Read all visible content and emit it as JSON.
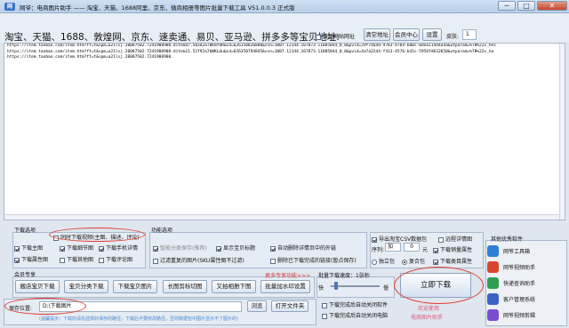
{
  "window": {
    "title": "网爷：电商图片助手 —— 淘宝、天猫、1688阿里、京东、微商相册等图片批量下载工具 V51.0.0.3 正式版",
    "icon": "网",
    "min": "─",
    "max": "□",
    "close": "✕"
  },
  "topbar": {
    "platforms": "淘宝、天猫、1688、敦煌网、京东、速卖通、易贝、亚马逊、拼多多等宝贝地址:",
    "auto_paste": "自动粘贴网址",
    "clear": "清空地址",
    "member": "会员中心",
    "settings": "设置",
    "skin_label": "皮肤:",
    "skin_value": "1"
  },
  "urls": [
    "https://item.taobao.com/item.htm?ft=t&spm=a21lsj.20087502.7241908900.ditem47.503d2a7bKmfdR&id=626150826880&ssn=1007.12144.167873.11085844_0_0&pvid=29f7da4d-9783-4704-b80c-0dea114d4a4a&utparam=%7B%22x_hes",
    "https://item.taobao.com/item.htm?ft=t&spm=a21lsj.20087502.7241908900.ditem11.52f92a7bWKLdu&id=626350794845&ssn=1007.12144.167873.11085844_0_0&pvid=4a7a2244-f413-4576-b41c-5956fd632650&utparam=%7B%22x_ha",
    "https://item.taobao.com/item.htm?ft=t&spm=a21lsj.20087502.7241908900."
  ],
  "opts": {
    "title": "下载选项",
    "video": "同时下载视频(主图、描述、评论)",
    "main": "下载主图",
    "detail_img": "下载细节图",
    "sku": "下载手机详情",
    "attr": "下载属性图",
    "other": "下载其他图",
    "review": "下载评论图"
  },
  "func": {
    "title": "功能选项",
    "smart_cat": "智能分类保存(推荐)",
    "show_title": "显示宝贝标题",
    "auto_del": "自动删除详情页中的外链",
    "filter_dup": "过滤重复的图片(SKU属性图不过滤)",
    "del_done": "删除已下载完成的链接(暂点保存)"
  },
  "extra": {
    "export_csv": "导出淘宝CSV数据包",
    "remote_detail": "远程详情图",
    "seq_label": "序列:",
    "seq_add": "加",
    "seq_num": "0",
    "seq_unit": "元",
    "dl_all_attr": "下载销量属性",
    "dl_attr_shop": "下载类目属性",
    "single": "独立包",
    "multi": "复合包"
  },
  "member": {
    "title": "会员专享",
    "b1": "搬店宝贝下载",
    "b2": "宝贝分类下载",
    "b3": "下载宝贝图片",
    "b4": "长图剪标切图",
    "b5": "又拍相册下图",
    "b6": "批量加水印设置",
    "more": "更多专享功能>>>"
  },
  "batch": {
    "title": "批量下载速度：1张秒",
    "slow": "快",
    "fast": "慢",
    "auto_off": "下载完成后自动关闭软件",
    "auto_pc": "下载完成后自动关闭电脑"
  },
  "save": {
    "label": "保存位置:",
    "path": "D:\\下载图片",
    "browse": "浏览",
    "open": "打开文件夹",
    "hint": "(温馨提示：下载前请先选择好保存的路径，下载后不要修改路径，否则数据包中图片显示不了图片的)"
  },
  "start": {
    "label": "立即下载",
    "welcome": "欢迎使用",
    "brand": "电商图片助手"
  },
  "side": {
    "title": "其他优秀软件",
    "items": [
      {
        "label": "网爷工具箱",
        "color": "#2f7fd7"
      },
      {
        "label": "网爷视频助手",
        "color": "#d8462e"
      },
      {
        "label": "快递查询助手",
        "color": "#2f9e52"
      },
      {
        "label": "客户管理系统",
        "color": "#3b62c5"
      },
      {
        "label": "网爷视频剪辑",
        "color": "#7a4ccf"
      }
    ]
  },
  "colors": {
    "accent_red": "#e23b2f",
    "brand_pink": "#e0567a"
  }
}
